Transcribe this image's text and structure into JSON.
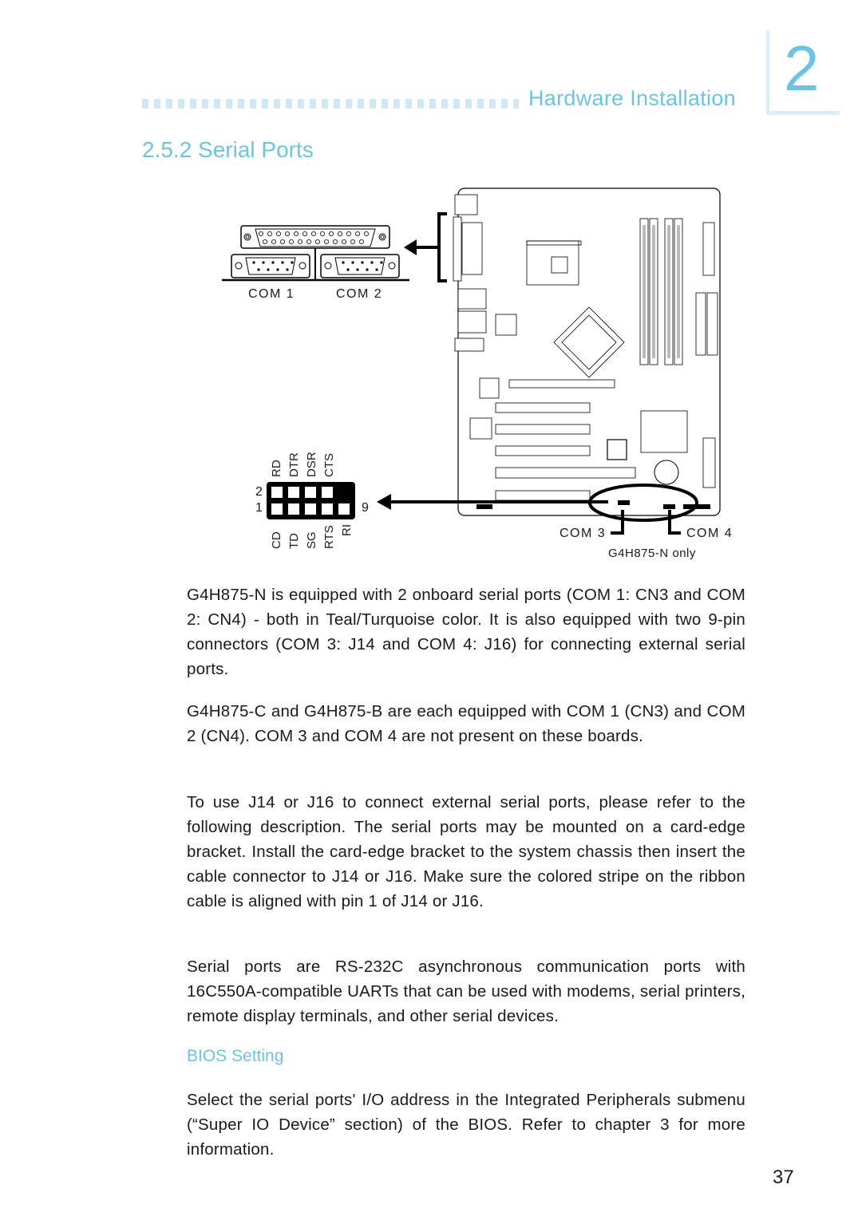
{
  "header": {
    "section_name": "Hardware Installation",
    "chapter_number": "2"
  },
  "section": {
    "title": "2.5.2  Serial Ports"
  },
  "figure": {
    "com1_label": "COM 1",
    "com2_label": "COM 2",
    "com3_label": "COM 3",
    "com4_label": "COM 4",
    "note": "G4H875-N  only",
    "pin_labels_top": [
      "RD",
      "DTR",
      "DSR",
      "CTS"
    ],
    "pin_labels_bottom": [
      "CD",
      "TD",
      "SG",
      "RTS",
      "RI"
    ],
    "pin_row_2": "2",
    "pin_row_1": "1",
    "pin_9": "9"
  },
  "body": {
    "paragraphs": [
      "G4H875-N  is equipped with 2 onboard serial ports (COM 1: CN3 and COM 2: CN4) - both in Teal/Turquoise color. It is also equipped with two 9-pin connectors (COM 3: J14 and COM 4: J16) for connecting external serial ports.",
      "G4H875-C and G4H875-B are each equipped with COM 1 (CN3) and COM 2 (CN4). COM 3 and COM 4 are not present on these boards.",
      "To use J14 or J16 to connect external serial ports, please refer to the following description. The serial ports may be mounted on a card-edge bracket. Install the card-edge bracket to the system chassis then insert the cable connector to J14 or J16. Make sure the colored stripe on the ribbon cable is aligned with pin 1 of J14 or J16.",
      "Serial ports are RS-232C asynchronous communication ports with 16C550A-compatible UARTs that can be used with modems, serial printers, remote display terminals, and other serial devices."
    ],
    "bios_heading": "BIOS Setting",
    "bios_paragraph": "Select the serial ports' I/O address in the Integrated Peripherals submenu (“Super IO Device” section) of the BIOS. Refer to chapter 3 for more information."
  },
  "footer": {
    "page_number": "37"
  },
  "colors": {
    "accent": "#6cc3e3",
    "accent_light": "#d9eef7",
    "text": "#1a1a1a"
  }
}
